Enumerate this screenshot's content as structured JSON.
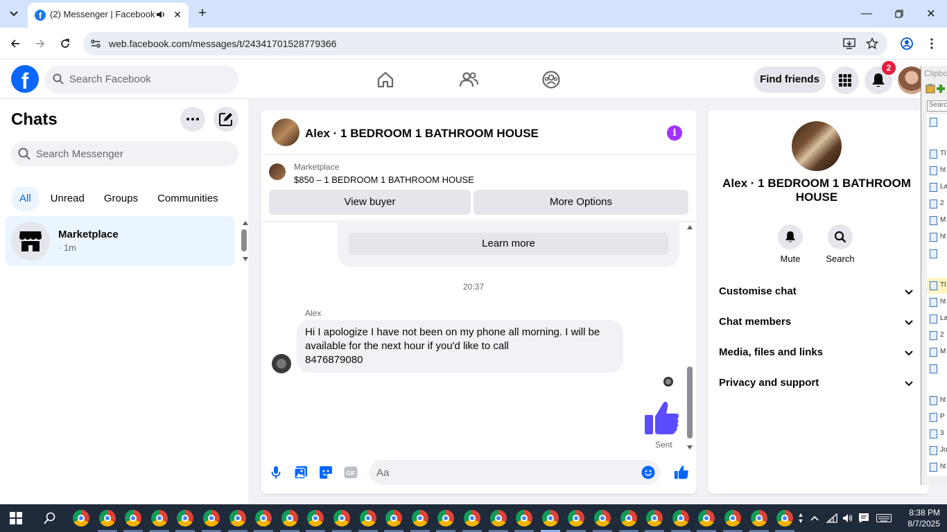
{
  "browser": {
    "tab_title": "(2) Messenger | Facebook",
    "url": "web.facebook.com/messages/t/24341701528779366"
  },
  "facebook": {
    "search_placeholder": "Search Facebook",
    "find_friends": "Find friends",
    "notification_count": "2"
  },
  "chats": {
    "title": "Chats",
    "search_placeholder": "Search Messenger",
    "filters": [
      "All",
      "Unread",
      "Groups",
      "Communities"
    ],
    "active_filter": "All",
    "items": [
      {
        "name": "Marketplace",
        "meta": "· 1m"
      }
    ]
  },
  "conversation": {
    "title": "Alex · 1 BEDROOM 1 BATHROOM HOUSE",
    "marketplace_label": "Marketplace",
    "listing": "$850 – 1 BEDROOM 1 BATHROOM HOUSE",
    "view_buyer": "View buyer",
    "more_options": "More Options",
    "learn_more": "Learn more",
    "timestamp": "20:37",
    "sender": "Alex",
    "message_lines": [
      "Hi I apologize I have not been on my phone all morning. I will be",
      "available for the next hour if you'd like to call",
      "8476879080"
    ],
    "status": "Sent",
    "composer_placeholder": "Aa"
  },
  "info_panel": {
    "name": "Alex · 1 BEDROOM 1 BATHROOM HOUSE",
    "actions": [
      {
        "label": "Mute",
        "icon": "bell-icon"
      },
      {
        "label": "Search",
        "icon": "search-icon"
      }
    ],
    "sections": [
      "Customise chat",
      "Chat members",
      "Media, files and links",
      "Privacy and support"
    ]
  },
  "clipboard": {
    "title": "Clipboard",
    "search": "Search",
    "rows": [
      "",
      "Tl",
      "ht",
      "La",
      "2",
      "M",
      "ht",
      "",
      "Tl",
      "ht",
      "La",
      "2",
      "M",
      "",
      "ht",
      "P",
      "3",
      "Jo",
      "ht"
    ]
  },
  "taskbar": {
    "time": "8:38 PM",
    "date": "8/7/2025"
  },
  "colors": {
    "facebook_blue": "#0866ff",
    "messenger_purple": "#a033ff",
    "like_blue": "#5b4dff",
    "active_chat_bg": "#ebf5ff"
  }
}
